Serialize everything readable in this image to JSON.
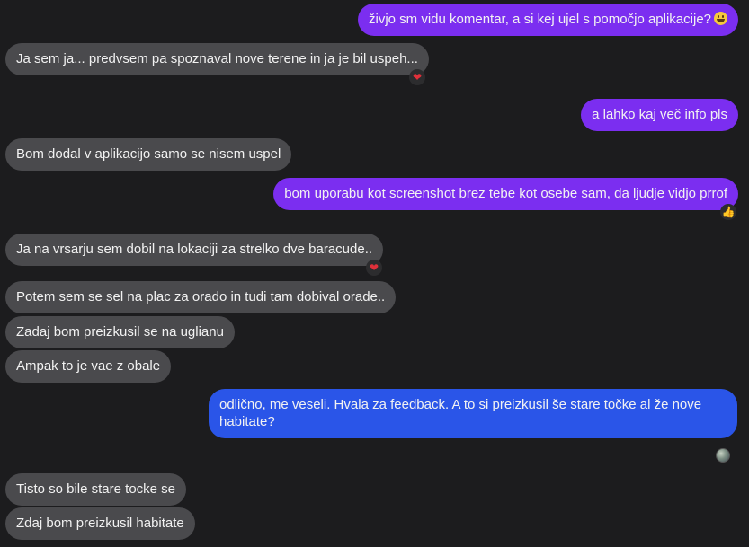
{
  "messages": [
    {
      "text": "živjo sm vidu komentar, a si kej ujel s pomočjo aplikacije?",
      "emoji": "smiley-icon"
    },
    {
      "text": "Ja sem ja... predvsem pa spoznaval nove terene in ja je bil uspeh...",
      "reaction": "❤"
    },
    {
      "text": "a lahko kaj več info pls"
    },
    {
      "text": "Bom dodal v aplikacijo samo se nisem uspel"
    },
    {
      "text": "bom uporabu kot screenshot brez tebe kot osebe sam, da ljudje vidjo prrof",
      "reaction": "👍"
    },
    {
      "text": "Ja na vrsarju sem dobil na lokaciji za strelko dve baracude..",
      "reaction": "❤"
    },
    {
      "text": "Potem sem se sel na plac za orado in tudi tam dobival orade.."
    },
    {
      "text": "Zadaj bom preizkusil se na uglianu"
    },
    {
      "text": "Ampak to je vae z obale"
    },
    {
      "text": "odlično, me veseli. Hvala za feedback. A to si preizkusil še stare točke al že nove habitate?"
    },
    {
      "text": "Tisto so bile stare tocke se"
    },
    {
      "text": "Zdaj bom preizkusil habitate"
    }
  ],
  "colors": {
    "background": "#1c1c1e",
    "incoming": "#4a4a4d",
    "outgoing_purple": "#7b2ef0",
    "outgoing_blue": "#2a55e8",
    "heart": "#e0303a"
  }
}
